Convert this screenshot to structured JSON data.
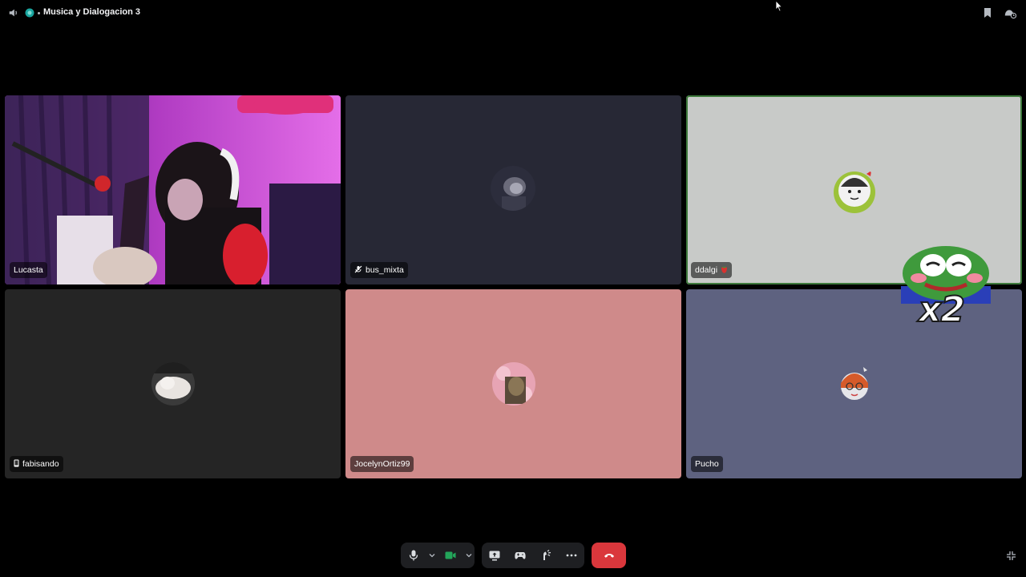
{
  "header": {
    "title": "Musica y Dialogacion 3"
  },
  "participants": [
    {
      "name": "Lucasta",
      "speaking": false,
      "bg": "#c23fc3"
    },
    {
      "name": "bus_mixta",
      "speaking": false,
      "bg": "#272835",
      "muted": true
    },
    {
      "name": "ddalgi",
      "speaking": true,
      "bg": "#c8cac8"
    },
    {
      "name": "fabisando",
      "speaking": false,
      "bg": "#252525",
      "mobile": true
    },
    {
      "name": "JocelynOrtiz99",
      "speaking": false,
      "bg": "#cf8a8a"
    },
    {
      "name": "Pucho",
      "speaking": false,
      "bg": "#5e6280"
    }
  ],
  "sticker": {
    "text": "x2"
  },
  "icons": {
    "speaker": "speaker-icon",
    "server": "server-icon",
    "bookmark": "bookmark-icon",
    "activity": "activity-icon",
    "mic": "microphone-icon",
    "camera": "camera-icon",
    "screen": "screen-share-icon",
    "game": "gamepad-icon",
    "soundboard": "soundboard-icon",
    "more": "more-icon",
    "hangup": "hang-up-icon",
    "collapse": "collapse-icon"
  },
  "colors": {
    "speaking_border": "#3e7a3c",
    "hangup": "#da373c",
    "camera_on": "#23a55a"
  }
}
